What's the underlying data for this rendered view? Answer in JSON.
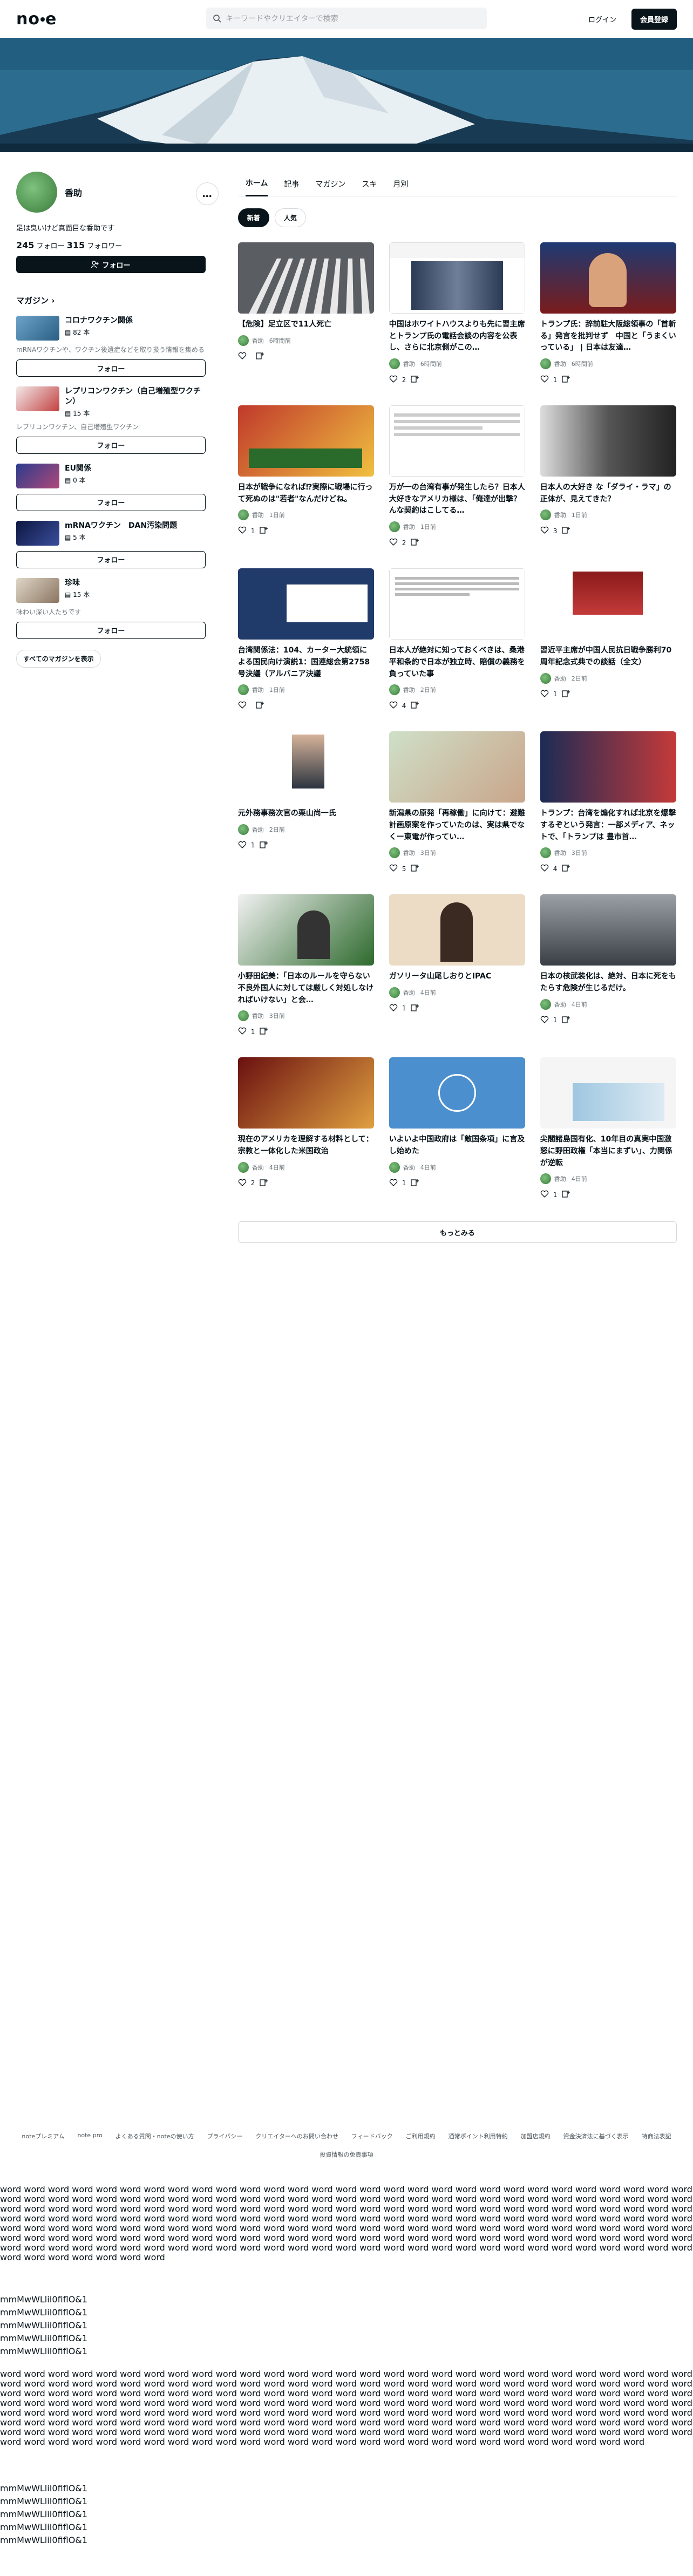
{
  "header": {
    "logo": "note",
    "search_placeholder": "キーワードやクリエイターで検索",
    "login": "ログイン",
    "signup": "会員登録"
  },
  "profile": {
    "name": "香助",
    "bio": "足は臭いけど真面目な香助です",
    "follow_count": "245",
    "follow_label": "フォロー",
    "follower_count": "315",
    "follower_label": "フォロワー",
    "follow_button": "フォロー"
  },
  "magazines": {
    "title": "マガジン",
    "items": [
      {
        "name": "コロナワクチン関係",
        "count": "82 本",
        "desc": "mRNAワクチンや、ワクチン後遺症などを取り扱う情報を集める",
        "follow": "フォロー"
      },
      {
        "name": "レプリコンワクチン（自己増殖型ワクチン）",
        "count": "15 本",
        "desc": "レプリコンワクチン、自己増殖型ワクチン",
        "follow": "フォロー"
      },
      {
        "name": "EU関係",
        "count": "0 本",
        "desc": "",
        "follow": "フォロー"
      },
      {
        "name": "mRNAワクチン　DAN汚染問題",
        "count": "5 本",
        "desc": "",
        "follow": "フォロー"
      },
      {
        "name": "珍味",
        "count": "15 本",
        "desc": "味わい深い人たちです",
        "follow": "フォロー"
      }
    ],
    "all_button": "すべてのマガジンを表示"
  },
  "tabs": [
    "ホーム",
    "記事",
    "マガジン",
    "スキ",
    "月別"
  ],
  "chips": [
    "新着",
    "人気"
  ],
  "articles": [
    {
      "title": "【危険】足立区で11人死亡",
      "author": "香助",
      "time": "6時間前",
      "likes": "",
      "thumb": "crosswalk"
    },
    {
      "title": "中国はホワイトハウスよりも先に習主席とトランプ氏の電話会談の内容を公表し、さらに北京側がこの…",
      "author": "香助",
      "time": "6時間前",
      "likes": "2",
      "thumb": "news"
    },
    {
      "title": "トランプ氏：辞前駐大阪総領事の「首斬る」発言を批判せず　中国と「うまくいっている」 | 日本は友達…",
      "author": "香助",
      "time": "6時間前",
      "likes": "1",
      "thumb": "trump"
    },
    {
      "title": "日本が戦争になれば⁉実際に戦場に行って死ぬのは\"若者\"なんだけどね。",
      "author": "香助",
      "time": "1日前",
      "likes": "1",
      "thumb": "youtube"
    },
    {
      "title": "万が一の台湾有事が発生したら？日本人大好きなアメリカ様は、「俺達が出撃？んな契約はこしてる…",
      "author": "香助",
      "time": "1日前",
      "likes": "2",
      "thumb": "tweet"
    },
    {
      "title": "日本人の大好き な「ダライ・ラマ」の正体が、見えてきた？",
      "author": "香助",
      "time": "1日前",
      "likes": "3",
      "thumb": "bw"
    },
    {
      "title": "台湾関係法：104、カーター大統領による国民向け演説1：国連総会第2758号決議（アルバニア決議",
      "author": "香助",
      "time": "1日前",
      "likes": "",
      "thumb": "historian"
    },
    {
      "title": "日本人が絶対に知っておくべきは、桑港平和条約で日本が独立時、賠償の義務を負っていた事",
      "author": "香助",
      "time": "2日前",
      "likes": "4",
      "thumb": "tweet2"
    },
    {
      "title": "習近平主席が中国人民抗日戦争勝利70周年記念式典での談話（全文）",
      "author": "香助",
      "time": "2日前",
      "likes": "1",
      "thumb": "xi"
    },
    {
      "title": "元外務事務次官の栗山尚一氏",
      "author": "香助",
      "time": "2日前",
      "likes": "1",
      "thumb": "kuriyama"
    },
    {
      "title": "新潟県の原発「再稼働」に向けて：避難計画原案を作っていたのは、実は県でなくー東電が作ってい…",
      "author": "香助",
      "time": "3日前",
      "likes": "5",
      "thumb": "face"
    },
    {
      "title": "トランプ：台湾を煽化すれば北京を爆撃するぞという発言：一部メディア、ネットで、「トランプは 豊市首…",
      "author": "香助",
      "time": "3日前",
      "likes": "4",
      "thumb": "trumpxi"
    },
    {
      "title": "小野田紀美：「日本のルールを守らない不良外国人に対しては厳しく対処しなければいけない」と会…",
      "author": "香助",
      "time": "3日前",
      "likes": "1",
      "thumb": "onoda"
    },
    {
      "title": "ガソリータ山尾しおりとIPAC",
      "author": "香助",
      "time": "4日前",
      "likes": "1",
      "thumb": "yamao"
    },
    {
      "title": "日本の核武装化は、絶対、日本に死をもたらす危険が生じるだけ。",
      "author": "香助",
      "time": "4日前",
      "likes": "1",
      "thumb": "missile"
    },
    {
      "title": "現在のアメリカを理解する材料として：宗教と一体化した米国政治",
      "author": "香助",
      "time": "4日前",
      "likes": "2",
      "thumb": "trumpvid"
    },
    {
      "title": "いよいよ中国政府は「敵国条項」に言及し始めた",
      "author": "香助",
      "time": "4日前",
      "likes": "1",
      "thumb": "un"
    },
    {
      "title": "尖閣諸島国有化、10年目の真実中国激怒に野田政権「本当にまずい」、力関係が逆転",
      "author": "香助",
      "time": "4日前",
      "likes": "1",
      "thumb": "senkaku"
    }
  ],
  "more_button": "もっとみる",
  "footer": {
    "links": [
      "noteプレミアム",
      "note pro",
      "よくある質問・noteの使い方",
      "プライバシー",
      "クリエイターへのお問い合わせ",
      "フィードバック",
      "ご利用規約",
      "通常ポイント利用特約",
      "加盟店規約",
      "資金決済法に基づく表示",
      "特商法表記"
    ],
    "links2": [
      "投資情報の免責事項"
    ]
  },
  "filler_text": "word",
  "mono_lines": [
    "mmMwWLliI0fiflO&1",
    "mmMwWLliI0fiflO&1",
    "mmMwWLliI0fiflO&1",
    "mmMwWLliI0fiflO&1",
    "mmMwWLliI0fiflO&1"
  ]
}
